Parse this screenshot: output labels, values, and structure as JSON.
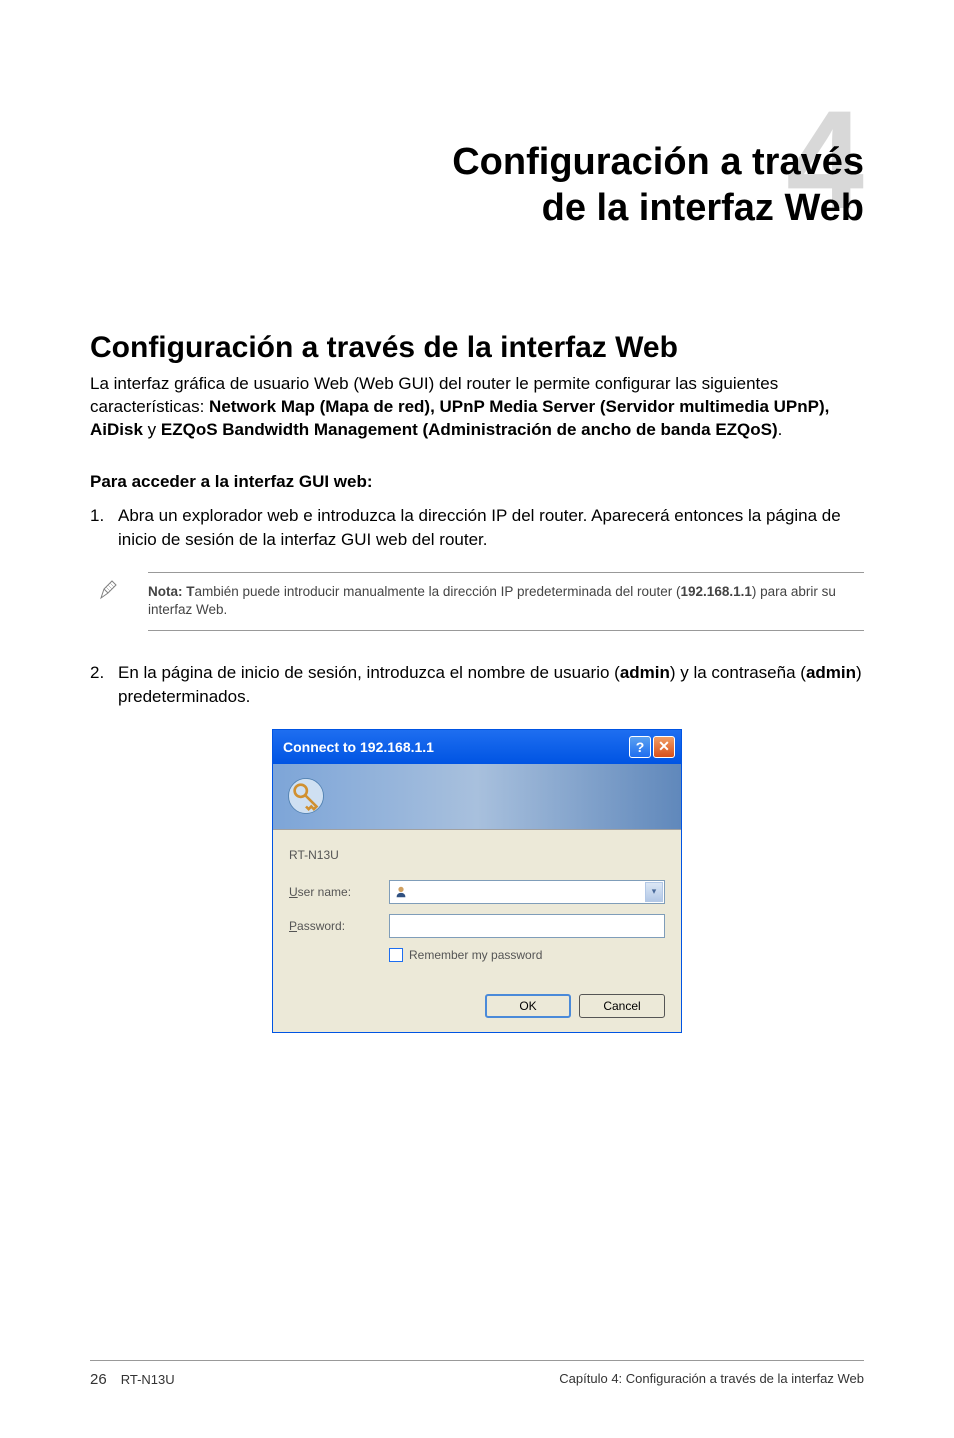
{
  "chapter": {
    "number": "4",
    "title_line1": "Configuración a través",
    "title_line2": "de la interfaz Web"
  },
  "section": {
    "title": "Configuración a través de la interfaz Web",
    "intro_pre": "La interfaz gráfica de usuario Web (Web GUI) del router le permite configurar las siguientes características: ",
    "intro_bold1": "Network Map (Mapa de red), UPnP Media Server (Servidor multimedia UPnP), AiDisk",
    "intro_mid": " y ",
    "intro_bold2": "EZQoS Bandwidth Management (Administración de ancho de banda EZQoS)",
    "intro_post": "."
  },
  "steps": {
    "heading": "Para acceder a la interfaz GUI web:",
    "item1_num": "1.",
    "item1_text": "Abra un explorador web e introduzca la dirección IP del router. Aparecerá entonces la página de inicio de sesión de la interfaz GUI web del router.",
    "item2_num": "2.",
    "item2_pre": "En la página de inicio de sesión, introduzca el nombre de usuario (",
    "item2_bold1": "admin",
    "item2_mid": ") y la contraseña (",
    "item2_bold2": "admin",
    "item2_post": ") predeterminados."
  },
  "note": {
    "prefix": "Nota: T",
    "text1": "ambién puede introducir manualmente la dirección IP predeterminada del router (",
    "bold": "192.168.1.1",
    "text2": ") para abrir su interfaz Web."
  },
  "dialog": {
    "title": "Connect to 192.168.1.1",
    "help_glyph": "?",
    "close_glyph": "✕",
    "device": "RT-N13U",
    "username_u": "U",
    "username_label": "ser name:",
    "password_p": "P",
    "password_label": "assword:",
    "remember_r": "R",
    "remember_label": "emember my password",
    "ok": "OK",
    "cancel": "Cancel",
    "combo_arrow": "▾"
  },
  "footer": {
    "page": "26",
    "model": "RT-N13U",
    "chapter_label": "Capítulo 4: Configuración a través de la interfaz Web"
  }
}
